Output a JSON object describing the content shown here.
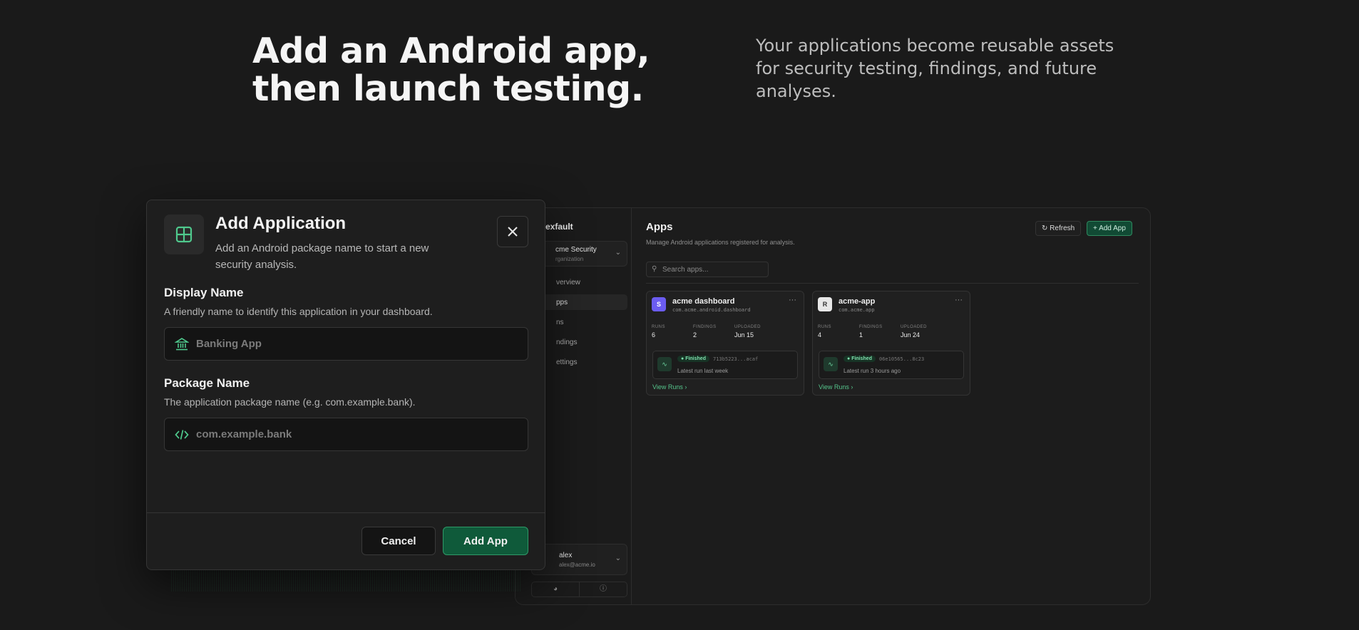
{
  "hero": {
    "title_line1": "Add an Android app,",
    "title_line2": "then launch testing.",
    "sub_line1": "Your applications become reusable assets",
    "sub_line2": "for security testing, findings, and future",
    "sub_line3": "analyses."
  },
  "sidebar": {
    "brand": "exfault",
    "org_name": "cme Security",
    "org_type": "rganization",
    "items": [
      {
        "label": "verview",
        "active": false
      },
      {
        "label": "pps",
        "active": true
      },
      {
        "label": "ns",
        "active": false
      },
      {
        "label": "ndings",
        "active": false
      },
      {
        "label": "ettings",
        "active": false
      }
    ],
    "user_name": "alex",
    "user_email": "alex@acme.io"
  },
  "main": {
    "title": "Apps",
    "subtitle": "Manage Android applications registered for analysis.",
    "refresh_label": "Refresh",
    "add_app_label": "+ Add App",
    "search_placeholder": "Search apps..."
  },
  "apps": [
    {
      "avatar": "S",
      "avatar_color": "#6b5cf0",
      "name": "acme dashboard",
      "package": "com.acme.android.dashboard",
      "runs_label": "RUNS",
      "runs": "6",
      "findings_label": "FINDINGS",
      "findings": "2",
      "uploaded_label": "UPLOADED",
      "uploaded": "Jun 15",
      "status": "Finished",
      "hash": "713b5223...acaf",
      "latest": "Latest run last week",
      "view_runs": "View Runs"
    },
    {
      "avatar": "R",
      "avatar_color": "#e8e8e8",
      "name": "acme-app",
      "package": "com.acme.app",
      "runs_label": "RUNS",
      "runs": "4",
      "findings_label": "FINDINGS",
      "findings": "1",
      "uploaded_label": "UPLOADED",
      "uploaded": "Jun 24",
      "status": "Finished",
      "hash": "06e10565...8c23",
      "latest": "Latest run 3 hours ago",
      "view_runs": "View Runs"
    }
  ],
  "dialog": {
    "title": "Add Application",
    "subtitle": "Add an Android package name to start a new security analysis.",
    "display_name_label": "Display Name",
    "display_name_help": "A friendly name to identify this application in your dashboard.",
    "display_name_placeholder": "Banking App",
    "display_name_value": "",
    "package_name_label": "Package Name",
    "package_name_help": "The application package name (e.g. com.example.bank).",
    "package_name_placeholder": "com.example.bank",
    "package_name_value": "",
    "cancel_label": "Cancel",
    "submit_label": "Add App"
  },
  "colors": {
    "accent": "#0f5a3a",
    "accent_border": "#2e9a68",
    "icon_green": "#4fc98d",
    "background": "#1a1a1a"
  }
}
